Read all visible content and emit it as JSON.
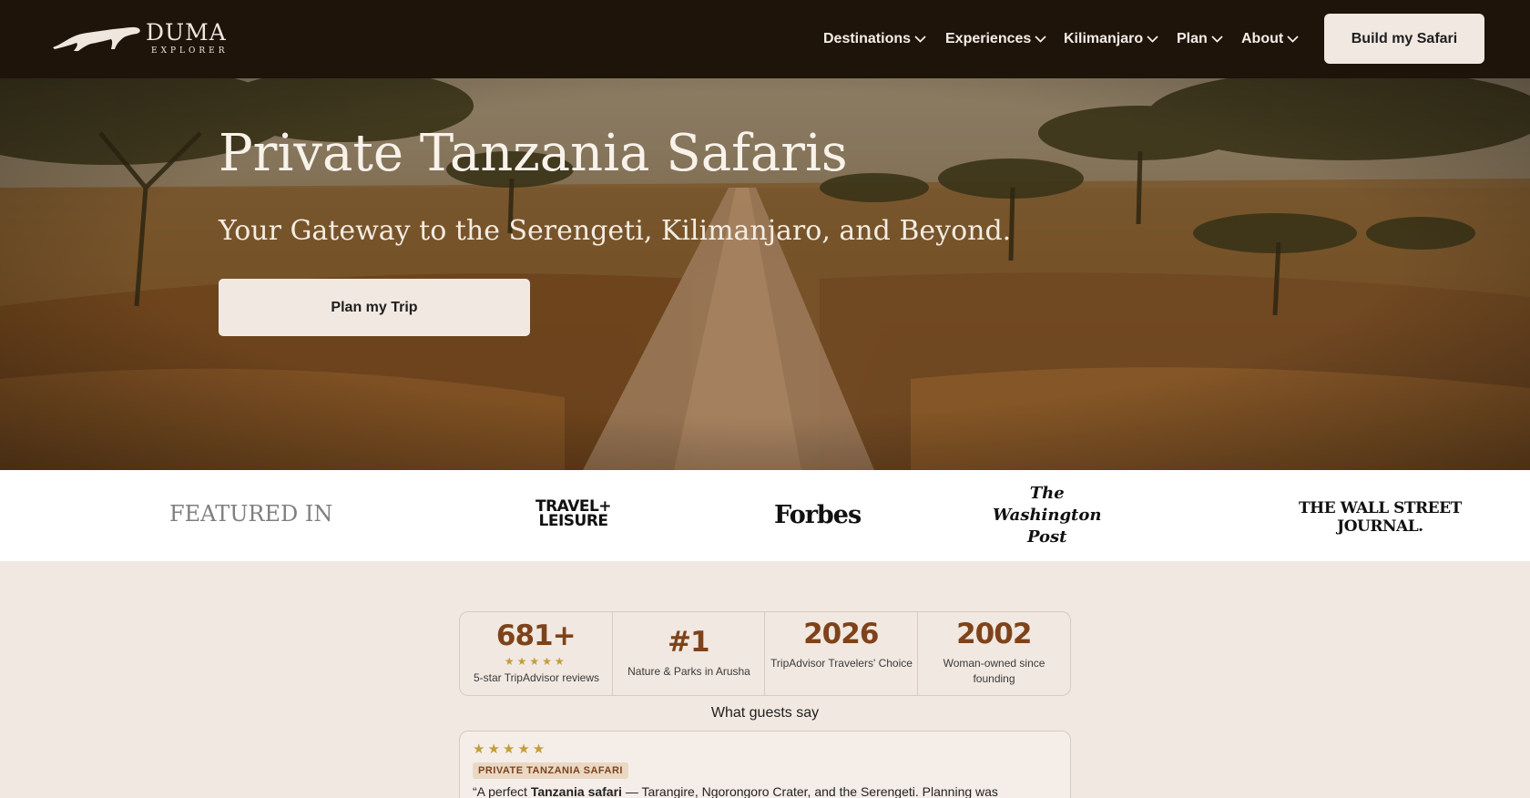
{
  "brand": {
    "name": "DUMA",
    "tagline": "EXPLORER"
  },
  "nav": {
    "items": [
      {
        "label": "Destinations"
      },
      {
        "label": "Experiences"
      },
      {
        "label": "Kilimanjaro"
      },
      {
        "label": "Plan"
      },
      {
        "label": "About"
      }
    ],
    "cta_label": "Build my Safari"
  },
  "hero": {
    "title": "Private Tanzania Safaris",
    "subtitle": "Your Gateway to the Serengeti, Kilimanjaro, and Beyond.",
    "cta_label": "Plan my Trip"
  },
  "featured": {
    "label": "FEATURED IN",
    "publications": [
      {
        "line1": "TRAVEL+",
        "line2": "LEISURE"
      },
      {
        "line1": "Forbes"
      },
      {
        "line1": "The",
        "line2": "Washington",
        "line3": "Post"
      },
      {
        "line1": "THE WALL STREET",
        "line2": "JOURNAL."
      }
    ]
  },
  "stats": [
    {
      "value": "681+",
      "stars": "★★★★★",
      "caption": "5-star TripAdvisor reviews"
    },
    {
      "value": "#1",
      "caption": "Nature & Parks in Arusha"
    },
    {
      "value": "2026",
      "caption": "TripAdvisor Travelers' Choice"
    },
    {
      "value": "2002",
      "caption": "Woman-owned since founding"
    }
  ],
  "guests": {
    "title": "What guests say",
    "review": {
      "stars": "★★★★★",
      "tag": "PRIVATE TANZANIA SAFARI",
      "text_before": "“A perfect ",
      "text_bold": "Tanzania safari",
      "text_after": " — Tarangire, Ngorongoro Crater, and the Serengeti. Planning was"
    }
  },
  "colors": {
    "nav_bg": "#1f140a",
    "accent_brown": "#7e431a",
    "star_gold": "#c39d3a",
    "page_bg": "#f1e8e1"
  }
}
